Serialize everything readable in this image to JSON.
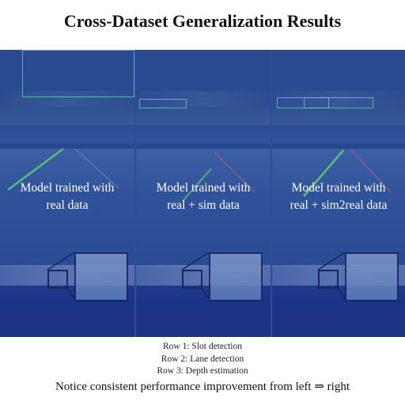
{
  "title": "Cross-Dataset Generalization Results",
  "panels": [
    {
      "caption_line1": "Model trained with",
      "caption_line2": "real data"
    },
    {
      "caption_line1": "Model trained with",
      "caption_line2": "real + sim data"
    },
    {
      "caption_line1": "Model trained with",
      "caption_line2": "real + sim2real data"
    }
  ],
  "notes": {
    "row1": "Row 1: Slot detection",
    "row2": "Row 2: Lane detection",
    "row3": "Row 3: Depth estimation",
    "summary": "Notice consistent performance improvement from left ⇒ right"
  },
  "colors": {
    "overlay": "#1f3a86",
    "lane_green": "#5fd070",
    "lane_red": "#d06070",
    "slot_box": "#6fd0c0"
  }
}
